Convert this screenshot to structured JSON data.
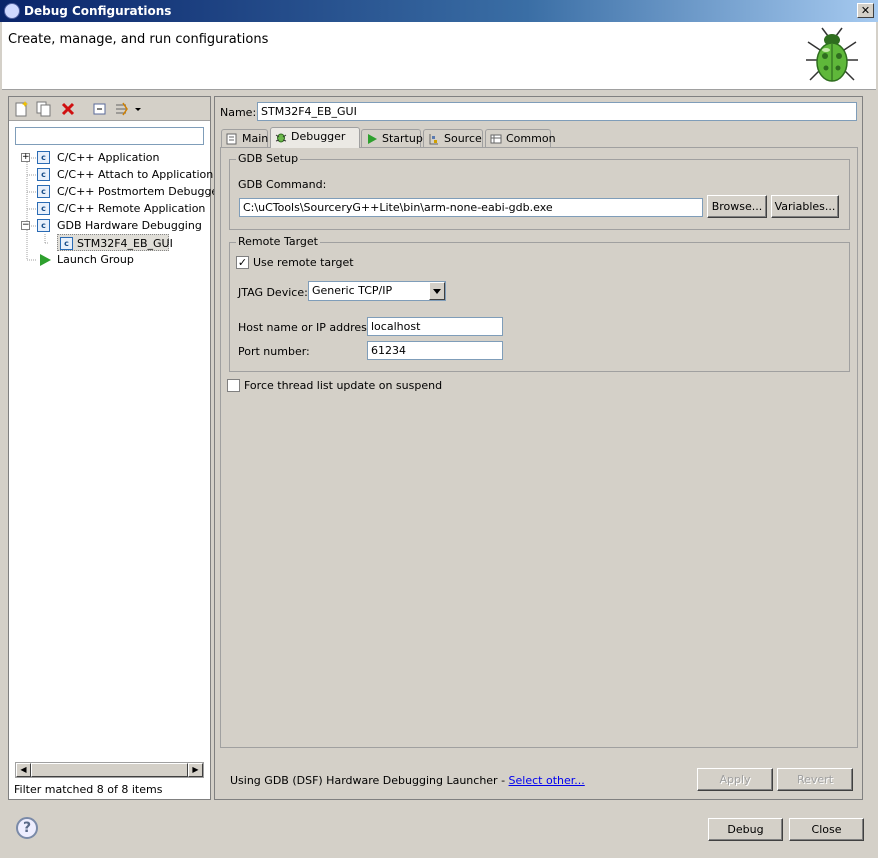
{
  "window": {
    "title": "Debug Configurations",
    "close_glyph": "✕"
  },
  "header": {
    "title": "Create, manage, and run configurations"
  },
  "left_panel": {
    "filter_placeholder": "",
    "tree": [
      {
        "label": "C/C++ Application",
        "expander": "+",
        "icon": "c-config-icon"
      },
      {
        "label": "C/C++ Attach to Application",
        "icon": "c-config-icon"
      },
      {
        "label": "C/C++ Postmortem Debugger",
        "icon": "c-config-icon"
      },
      {
        "label": "C/C++ Remote Application",
        "icon": "c-config-icon"
      },
      {
        "label": "GDB Hardware Debugging",
        "expander": "−",
        "icon": "c-config-icon"
      },
      {
        "label": "STM32F4_EB_GUI",
        "icon": "c-config-icon",
        "selected": true
      },
      {
        "label": "Launch Group",
        "icon": "launch-group-icon"
      }
    ],
    "icon_letter": "c",
    "filter_status": "Filter matched 8 of 8 items"
  },
  "config": {
    "name_label": "Name:",
    "name_value": "STM32F4_EB_GUI",
    "tabs": [
      {
        "label": "Main"
      },
      {
        "label": "Debugger",
        "active": true
      },
      {
        "label": "Startup"
      },
      {
        "label": "Source"
      },
      {
        "label": "Common"
      }
    ],
    "gdb_setup": {
      "group_label": "GDB Setup",
      "command_label": "GDB Command:",
      "command_value": "C:\\uCTools\\SourceryG++Lite\\bin\\arm-none-eabi-gdb.exe",
      "browse_label": "Browse...",
      "variables_label": "Variables..."
    },
    "remote_target": {
      "group_label": "Remote Target",
      "use_remote_label": "Use remote target",
      "use_remote_checked": true,
      "jtag_label": "JTAG Device:",
      "jtag_value": "Generic TCP/IP",
      "host_label": "Host name or IP address:",
      "host_value": "localhost",
      "port_label": "Port number:",
      "port_value": "61234"
    },
    "force_thread_label": "Force thread list update on suspend",
    "force_thread_checked": false,
    "launcher_text": "Using GDB (DSF) Hardware Debugging Launcher - ",
    "select_other": "Select other...",
    "apply_label": "Apply",
    "revert_label": "Revert"
  },
  "footer": {
    "help_glyph": "?",
    "debug_label": "Debug",
    "close_label": "Close"
  },
  "colors": {
    "titlebar": "#0a246a",
    "dialog_bg": "#d4d0c8",
    "link": "#0000ee"
  }
}
